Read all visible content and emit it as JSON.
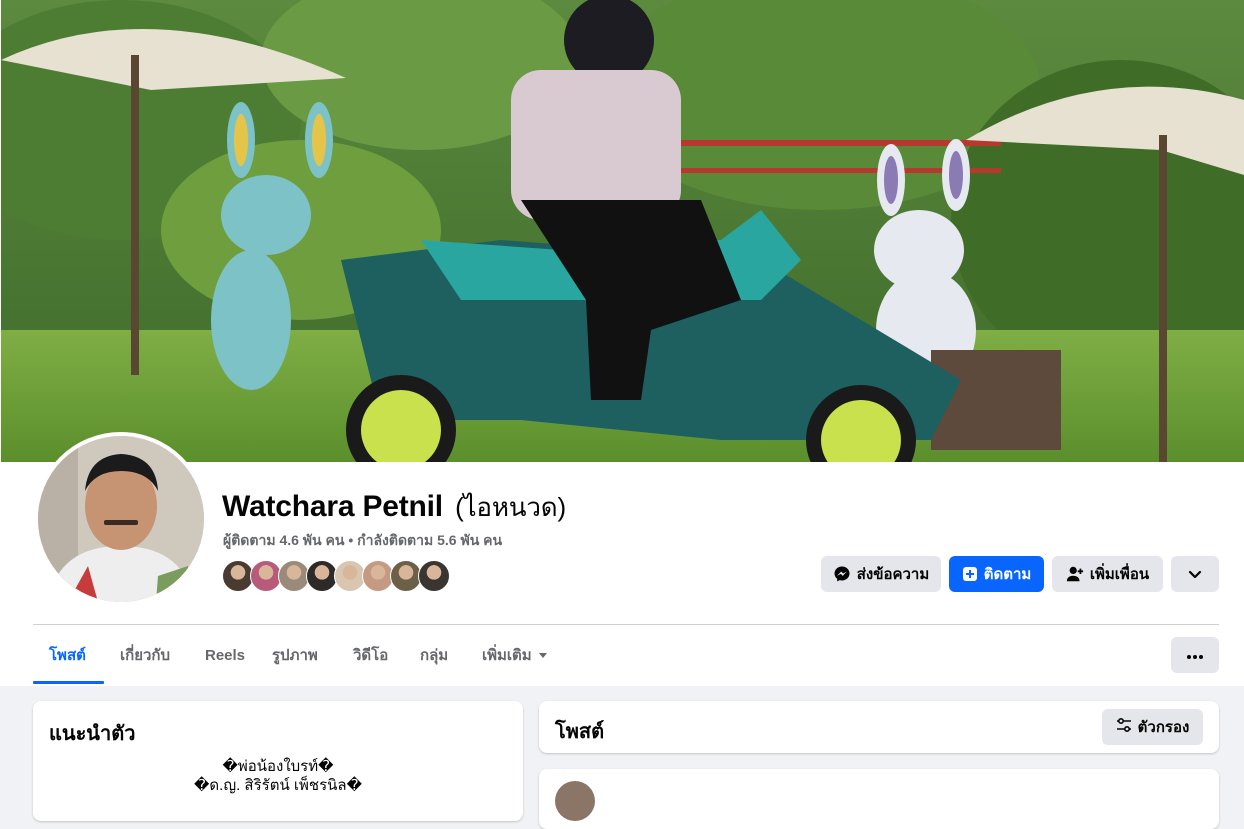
{
  "profile": {
    "name": "Watchara Petnil",
    "alt_name": "(ไอหนวด)",
    "stats": "ผู้ติดตาม 4.6 พัน คน • กำลังติดตาม 5.6 พัน คน",
    "friend_avatar_colors": [
      "#4a3b32",
      "#b85a7a",
      "#9a8a7a",
      "#2e2a2a",
      "#d8c6b0",
      "#c49a82",
      "#6d6048",
      "#3a3530"
    ]
  },
  "actions": {
    "message": "ส่งข้อความ",
    "follow": "ติดตาม",
    "add_friend": "เพิ่มเพื่อน"
  },
  "tabs": [
    {
      "label": "โพสต์",
      "active": true
    },
    {
      "label": "เกี่ยวกับ",
      "active": false
    },
    {
      "label": "Reels",
      "active": false
    },
    {
      "label": "รูปภาพ",
      "active": false
    },
    {
      "label": "วิดีโอ",
      "active": false
    },
    {
      "label": "กลุ่ม",
      "active": false
    },
    {
      "label": "เพิ่มเติม",
      "active": false
    }
  ],
  "intro": {
    "title": "แนะนำตัว",
    "line1": "�พ่อน้องใบรท์�",
    "line2": "�ด.ญ. สิริรัตน์ เพ็ชรนิล�"
  },
  "posts": {
    "title": "โพสต์",
    "filter": "ตัวกรอง"
  },
  "colors": {
    "accent": "#0866ff",
    "secondary_text": "#65676b",
    "button_gray": "#e4e6eb",
    "page_bg": "#f0f2f5"
  },
  "icons": [
    "messenger-icon",
    "follow-plus-icon",
    "add-person-icon",
    "chevron-down-icon",
    "more-dots-icon",
    "filter-sliders-icon",
    "caret-down-icon"
  ]
}
